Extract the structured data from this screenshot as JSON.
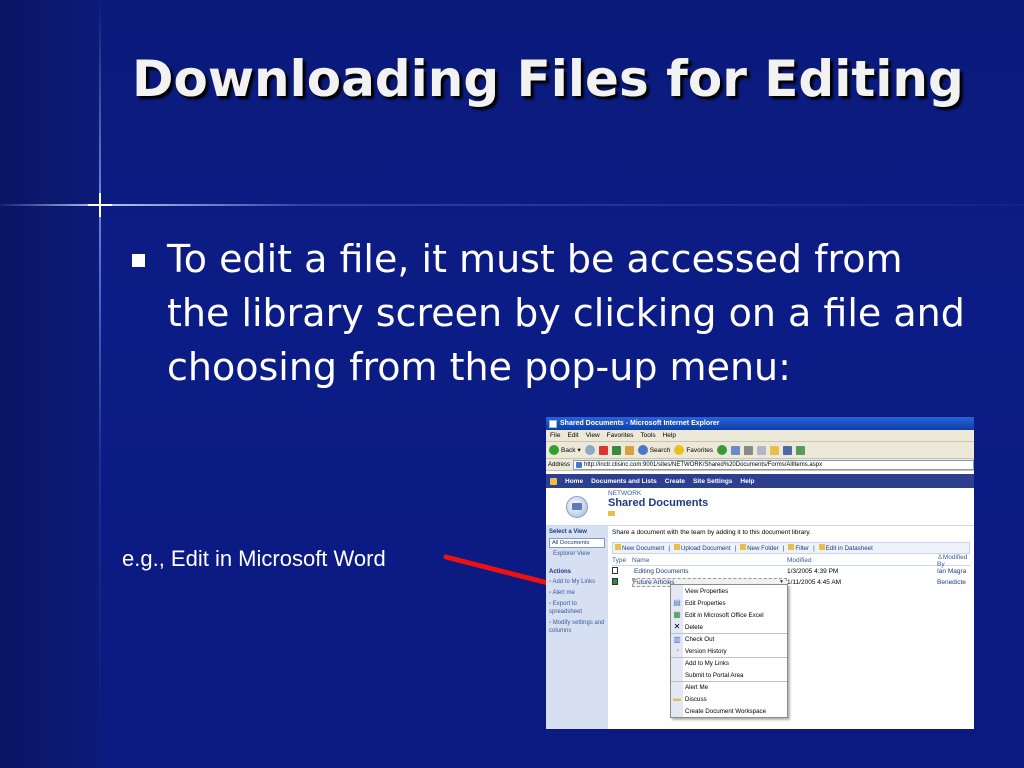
{
  "slide": {
    "title": "Downloading Files for Editing",
    "bullet": "To edit a file, it must be accessed from the library screen by clicking on a file and choosing from the pop-up menu:",
    "example_label": "e.g., Edit in Microsoft Word",
    "arrow_color": "#ee1111"
  },
  "browser": {
    "window_title": "Shared Documents - Microsoft Internet Explorer",
    "menu": [
      "File",
      "Edit",
      "View",
      "Favorites",
      "Tools",
      "Help"
    ],
    "toolbar": {
      "back_label": "Back",
      "search_label": "Search",
      "favorites_label": "Favorites"
    },
    "address_label": "Address",
    "address_value": "http://inctr.ctisinc.com:9001/sites/NETWORK/Shared%20Documents/Forms/AllItems.aspx"
  },
  "sharepoint": {
    "nav": [
      "Home",
      "Documents and Lists",
      "Create",
      "Site Settings",
      "Help"
    ],
    "site_name": "NETWORK",
    "library_title": "Shared Documents",
    "description": "Share a document with the team by adding it to this document library.",
    "left": {
      "select_view_heading": "Select a View",
      "views": [
        "All Documents",
        "Explorer View"
      ],
      "actions_heading": "Actions",
      "actions": [
        "Add to My Links",
        "Alert me",
        "Export to spreadsheet",
        "Modify settings and columns"
      ]
    },
    "toolbar": [
      "New Document",
      "Upload Document",
      "New Folder",
      "Filter",
      "Edit in Datasheet"
    ],
    "columns": [
      "Type",
      "Name",
      "Modified",
      "Modified By"
    ],
    "rows": [
      {
        "name": "Editing Documents",
        "modified": "1/3/2005 4:39 PM",
        "modified_by": "Ian Magra"
      },
      {
        "name": "Future Articles",
        "modified": "1/11/2005 4:45 AM",
        "modified_by": "Benedicte"
      }
    ],
    "context_menu": [
      "View Properties",
      "Edit Properties",
      "Edit in Microsoft Office Excel",
      "Delete",
      "Check Out",
      "Version History",
      "Add to My Links",
      "Submit to Portal Area",
      "Alert Me",
      "Discuss",
      "Create Document Workspace"
    ]
  }
}
